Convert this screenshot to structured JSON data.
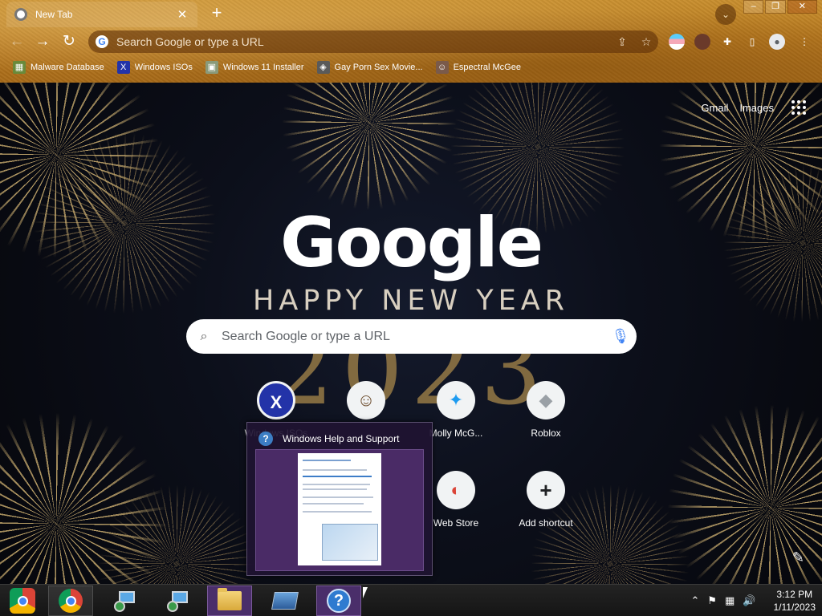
{
  "browser": {
    "tab_title": "New Tab",
    "tab_close": "✕",
    "new_tab": "+",
    "tab_search": "⌄",
    "window_controls": {
      "minimize": "–",
      "maximize": "❐",
      "close": "✕"
    },
    "nav": {
      "back": "←",
      "forward": "→",
      "reload": "↻"
    },
    "omnibox_placeholder": "Search Google or type a URL",
    "omnibox_share": "⇪",
    "omnibox_star": "☆",
    "extensions": {
      "puzzle": "✚",
      "sidepanel": "▯",
      "menu": "⋮"
    },
    "bookmarks": [
      {
        "label": "Malware Database",
        "icon": "grid-icon",
        "color": "#6a8a3a"
      },
      {
        "label": "Windows ISOs",
        "icon": "x-icon",
        "color": "#2333a8"
      },
      {
        "label": "Windows 11 Installer",
        "icon": "image-icon",
        "color": "#8a9a7a"
      },
      {
        "label": "Gay Porn Sex Movie...",
        "icon": "cube-icon",
        "color": "#5a5a5a"
      },
      {
        "label": "Espectral McGee",
        "icon": "avatar-icon",
        "color": "#7a5a4a"
      }
    ]
  },
  "ntp": {
    "top_links": {
      "gmail": "Gmail",
      "images": "Images"
    },
    "logo": "Google",
    "tagline": "HAPPY NEW YEAR",
    "year": "2023",
    "search_placeholder": "Search Google or type a URL",
    "search_icon": "⌕",
    "mic_icon": "🎙",
    "shortcuts": [
      {
        "label": "Windows ISOs",
        "icon": "x-icon",
        "glyph": "X",
        "color": "#2333a8"
      },
      {
        "label": "",
        "icon": "avatar-icon",
        "glyph": "☺",
        "color": "#6a4a2a"
      },
      {
        "label": "Molly McG...",
        "icon": "twitter-icon",
        "glyph": "✦",
        "color": "#1d9bf0"
      },
      {
        "label": "Roblox",
        "icon": "roblox-icon",
        "glyph": "◆",
        "color": "#9aa0a6"
      },
      {
        "label": "Web Store",
        "icon": "webstore-icon",
        "glyph": "◐",
        "color": "#db4437"
      },
      {
        "label": "Add shortcut",
        "icon": "plus-icon",
        "glyph": "+",
        "color": "#202124"
      }
    ],
    "edit_icon": "✎"
  },
  "taskbar": {
    "preview_title": "Windows Help and Support",
    "help_glyph": "?",
    "tray": {
      "chevron": "⌃",
      "flag": "⚑",
      "network": "▦",
      "volume": "🔊"
    },
    "time": "3:12 PM",
    "date": "1/11/2023"
  }
}
